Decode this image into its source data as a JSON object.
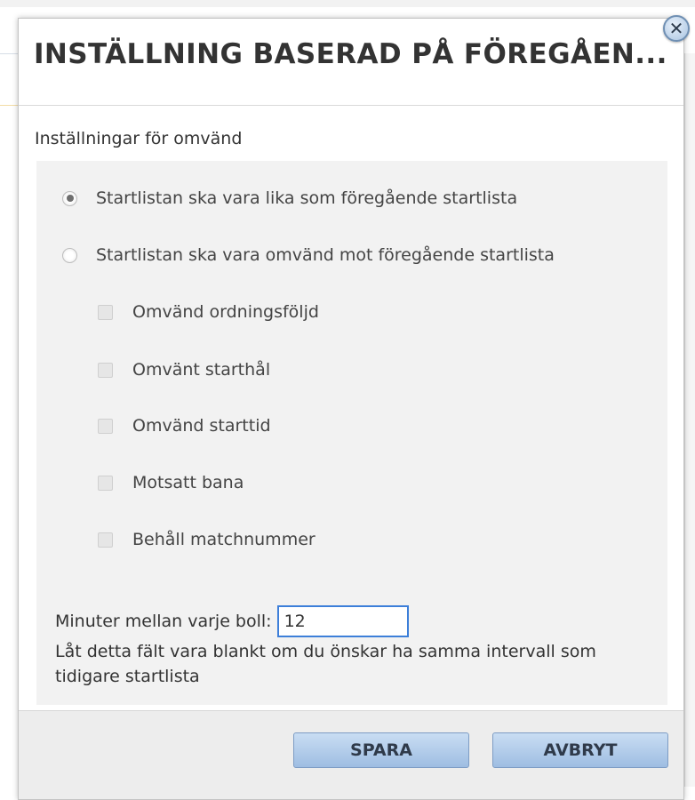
{
  "dialog": {
    "title": "INSTÄLLNING BASERAD PÅ FÖREGÅEN...",
    "close_icon": "close-icon"
  },
  "settings": {
    "section_label": "Inställningar för omvänd",
    "radio_options": [
      {
        "label": "Startlistan ska vara lika som föregående startlista",
        "selected": true
      },
      {
        "label": "Startlistan ska vara omvänd mot föregående startlista",
        "selected": false
      }
    ],
    "checkboxes": [
      {
        "label": "Omvänd ordningsföljd",
        "checked": false
      },
      {
        "label": "Omvänt starthål",
        "checked": false
      },
      {
        "label": "Omvänd starttid",
        "checked": false
      },
      {
        "label": "Motsatt bana",
        "checked": false
      },
      {
        "label": "Behåll matchnummer",
        "checked": false
      }
    ],
    "minutes_label": "Minuter mellan varje boll:",
    "minutes_value": "12",
    "hint": "Låt detta fält vara blankt om du önskar ha samma intervall som tidigare startlista"
  },
  "buttons": {
    "save_label": "SPARA",
    "cancel_label": "AVBRYT"
  },
  "colors": {
    "button_bg": "#b4cfee",
    "input_border": "#3d7fd9",
    "panel_bg": "#f2f2f2"
  }
}
